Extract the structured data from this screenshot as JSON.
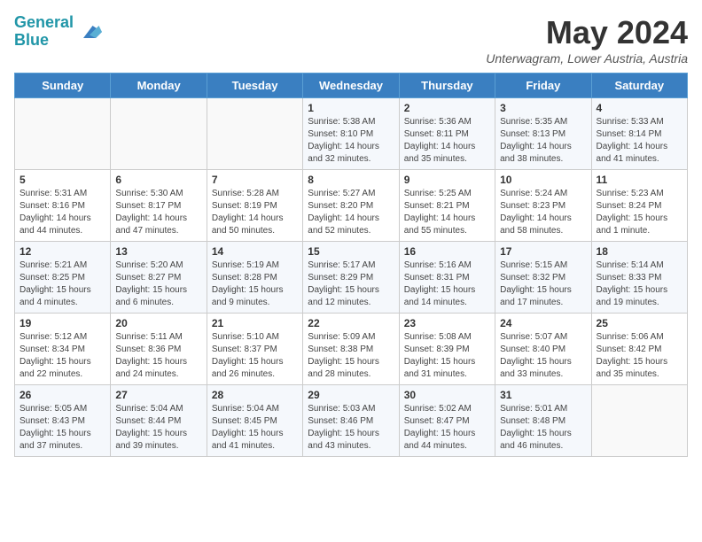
{
  "header": {
    "logo_line1": "General",
    "logo_line2": "Blue",
    "title": "May 2024",
    "location": "Unterwagram, Lower Austria, Austria"
  },
  "weekdays": [
    "Sunday",
    "Monday",
    "Tuesday",
    "Wednesday",
    "Thursday",
    "Friday",
    "Saturday"
  ],
  "weeks": [
    [
      {
        "day": "",
        "info": ""
      },
      {
        "day": "",
        "info": ""
      },
      {
        "day": "",
        "info": ""
      },
      {
        "day": "1",
        "info": "Sunrise: 5:38 AM\nSunset: 8:10 PM\nDaylight: 14 hours\nand 32 minutes."
      },
      {
        "day": "2",
        "info": "Sunrise: 5:36 AM\nSunset: 8:11 PM\nDaylight: 14 hours\nand 35 minutes."
      },
      {
        "day": "3",
        "info": "Sunrise: 5:35 AM\nSunset: 8:13 PM\nDaylight: 14 hours\nand 38 minutes."
      },
      {
        "day": "4",
        "info": "Sunrise: 5:33 AM\nSunset: 8:14 PM\nDaylight: 14 hours\nand 41 minutes."
      }
    ],
    [
      {
        "day": "5",
        "info": "Sunrise: 5:31 AM\nSunset: 8:16 PM\nDaylight: 14 hours\nand 44 minutes."
      },
      {
        "day": "6",
        "info": "Sunrise: 5:30 AM\nSunset: 8:17 PM\nDaylight: 14 hours\nand 47 minutes."
      },
      {
        "day": "7",
        "info": "Sunrise: 5:28 AM\nSunset: 8:19 PM\nDaylight: 14 hours\nand 50 minutes."
      },
      {
        "day": "8",
        "info": "Sunrise: 5:27 AM\nSunset: 8:20 PM\nDaylight: 14 hours\nand 52 minutes."
      },
      {
        "day": "9",
        "info": "Sunrise: 5:25 AM\nSunset: 8:21 PM\nDaylight: 14 hours\nand 55 minutes."
      },
      {
        "day": "10",
        "info": "Sunrise: 5:24 AM\nSunset: 8:23 PM\nDaylight: 14 hours\nand 58 minutes."
      },
      {
        "day": "11",
        "info": "Sunrise: 5:23 AM\nSunset: 8:24 PM\nDaylight: 15 hours\nand 1 minute."
      }
    ],
    [
      {
        "day": "12",
        "info": "Sunrise: 5:21 AM\nSunset: 8:25 PM\nDaylight: 15 hours\nand 4 minutes."
      },
      {
        "day": "13",
        "info": "Sunrise: 5:20 AM\nSunset: 8:27 PM\nDaylight: 15 hours\nand 6 minutes."
      },
      {
        "day": "14",
        "info": "Sunrise: 5:19 AM\nSunset: 8:28 PM\nDaylight: 15 hours\nand 9 minutes."
      },
      {
        "day": "15",
        "info": "Sunrise: 5:17 AM\nSunset: 8:29 PM\nDaylight: 15 hours\nand 12 minutes."
      },
      {
        "day": "16",
        "info": "Sunrise: 5:16 AM\nSunset: 8:31 PM\nDaylight: 15 hours\nand 14 minutes."
      },
      {
        "day": "17",
        "info": "Sunrise: 5:15 AM\nSunset: 8:32 PM\nDaylight: 15 hours\nand 17 minutes."
      },
      {
        "day": "18",
        "info": "Sunrise: 5:14 AM\nSunset: 8:33 PM\nDaylight: 15 hours\nand 19 minutes."
      }
    ],
    [
      {
        "day": "19",
        "info": "Sunrise: 5:12 AM\nSunset: 8:34 PM\nDaylight: 15 hours\nand 22 minutes."
      },
      {
        "day": "20",
        "info": "Sunrise: 5:11 AM\nSunset: 8:36 PM\nDaylight: 15 hours\nand 24 minutes."
      },
      {
        "day": "21",
        "info": "Sunrise: 5:10 AM\nSunset: 8:37 PM\nDaylight: 15 hours\nand 26 minutes."
      },
      {
        "day": "22",
        "info": "Sunrise: 5:09 AM\nSunset: 8:38 PM\nDaylight: 15 hours\nand 28 minutes."
      },
      {
        "day": "23",
        "info": "Sunrise: 5:08 AM\nSunset: 8:39 PM\nDaylight: 15 hours\nand 31 minutes."
      },
      {
        "day": "24",
        "info": "Sunrise: 5:07 AM\nSunset: 8:40 PM\nDaylight: 15 hours\nand 33 minutes."
      },
      {
        "day": "25",
        "info": "Sunrise: 5:06 AM\nSunset: 8:42 PM\nDaylight: 15 hours\nand 35 minutes."
      }
    ],
    [
      {
        "day": "26",
        "info": "Sunrise: 5:05 AM\nSunset: 8:43 PM\nDaylight: 15 hours\nand 37 minutes."
      },
      {
        "day": "27",
        "info": "Sunrise: 5:04 AM\nSunset: 8:44 PM\nDaylight: 15 hours\nand 39 minutes."
      },
      {
        "day": "28",
        "info": "Sunrise: 5:04 AM\nSunset: 8:45 PM\nDaylight: 15 hours\nand 41 minutes."
      },
      {
        "day": "29",
        "info": "Sunrise: 5:03 AM\nSunset: 8:46 PM\nDaylight: 15 hours\nand 43 minutes."
      },
      {
        "day": "30",
        "info": "Sunrise: 5:02 AM\nSunset: 8:47 PM\nDaylight: 15 hours\nand 44 minutes."
      },
      {
        "day": "31",
        "info": "Sunrise: 5:01 AM\nSunset: 8:48 PM\nDaylight: 15 hours\nand 46 minutes."
      },
      {
        "day": "",
        "info": ""
      }
    ]
  ]
}
